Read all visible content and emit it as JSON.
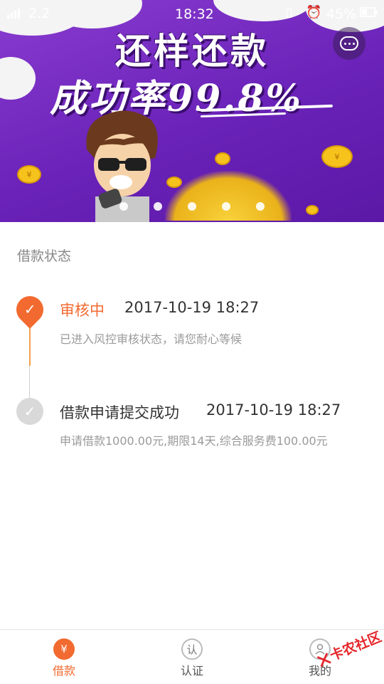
{
  "status_bar": {
    "network": "2.2",
    "time": "18:32",
    "battery": "45%",
    "battery_level": 0.45
  },
  "banner": {
    "headline": "还样还款",
    "rate_text": "成功率99.8%",
    "slides_total": 5,
    "accent_color": "#6a22b8"
  },
  "chat_button": {
    "icon": "chat-icon"
  },
  "loan_status": {
    "section_title": "借款状态",
    "steps": [
      {
        "title": "审核中",
        "time": "2017-10-19 18:27",
        "description": "已进入风控审核状态，请您耐心等候",
        "state": "current",
        "color": "#f26a2f"
      },
      {
        "title": "借款申请提交成功",
        "time": "2017-10-19 18:27",
        "description": "申请借款1000.00元,期限14天,综合服务费100.00元",
        "state": "done",
        "color": "#d9d9d9"
      }
    ]
  },
  "tabbar": {
    "tabs": [
      {
        "label": "借款",
        "icon_glyph": "¥",
        "icon": "yen-icon",
        "active": true
      },
      {
        "label": "认证",
        "icon_glyph": "认",
        "icon": "verify-icon",
        "active": false
      },
      {
        "label": "我的",
        "icon_glyph": "",
        "icon": "user-icon",
        "active": false
      }
    ],
    "active_color": "#f26a2f",
    "inactive_color": "#555555"
  },
  "watermark": {
    "text": "卡农社区",
    "icon": "cross-logo-icon"
  }
}
